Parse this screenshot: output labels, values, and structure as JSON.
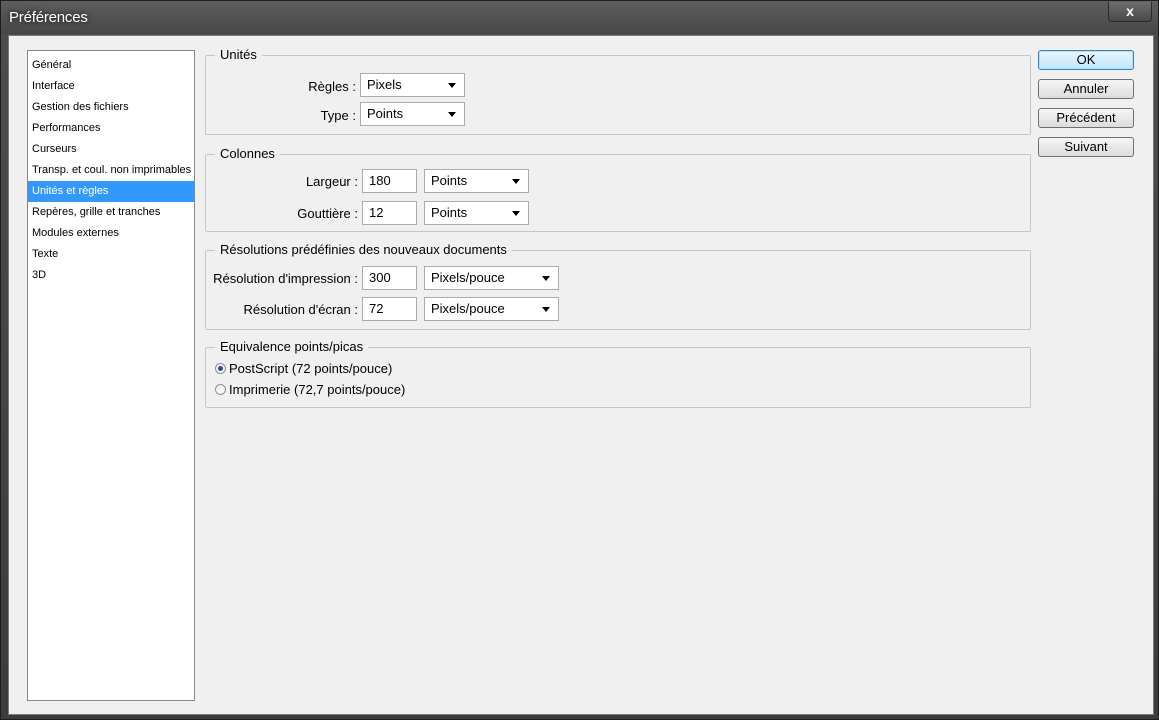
{
  "window": {
    "title": "Préférences",
    "close_label": "x"
  },
  "sidebar": {
    "items": [
      {
        "label": "Général"
      },
      {
        "label": "Interface"
      },
      {
        "label": "Gestion des fichiers"
      },
      {
        "label": "Performances"
      },
      {
        "label": "Curseurs"
      },
      {
        "label": "Transp. et coul. non imprimables"
      },
      {
        "label": "Unités et règles",
        "selected": true
      },
      {
        "label": "Repères, grille et tranches"
      },
      {
        "label": "Modules externes"
      },
      {
        "label": "Texte"
      },
      {
        "label": "3D"
      }
    ]
  },
  "units": {
    "legend": "Unités",
    "rulers_label": "Règles :",
    "rulers_value": "Pixels",
    "type_label": "Type :",
    "type_value": "Points"
  },
  "columns": {
    "legend": "Colonnes",
    "width_label": "Largeur :",
    "width_value": "180",
    "width_unit": "Points",
    "gutter_label": "Gouttière :",
    "gutter_value": "12",
    "gutter_unit": "Points"
  },
  "resolutions": {
    "legend": "Résolutions prédéfinies des nouveaux documents",
    "print_label": "Résolution d'impression :",
    "print_value": "300",
    "print_unit": "Pixels/pouce",
    "screen_label": "Résolution d'écran :",
    "screen_value": "72",
    "screen_unit": "Pixels/pouce"
  },
  "picas": {
    "legend": "Equivalence points/picas",
    "postscript_label": "PostScript (72 points/pouce)",
    "postscript_checked": true,
    "traditional_label": "Imprimerie (72,7 points/pouce)",
    "traditional_checked": false
  },
  "buttons": {
    "ok": "OK",
    "cancel": "Annuler",
    "prev": "Précédent",
    "next": "Suivant"
  }
}
